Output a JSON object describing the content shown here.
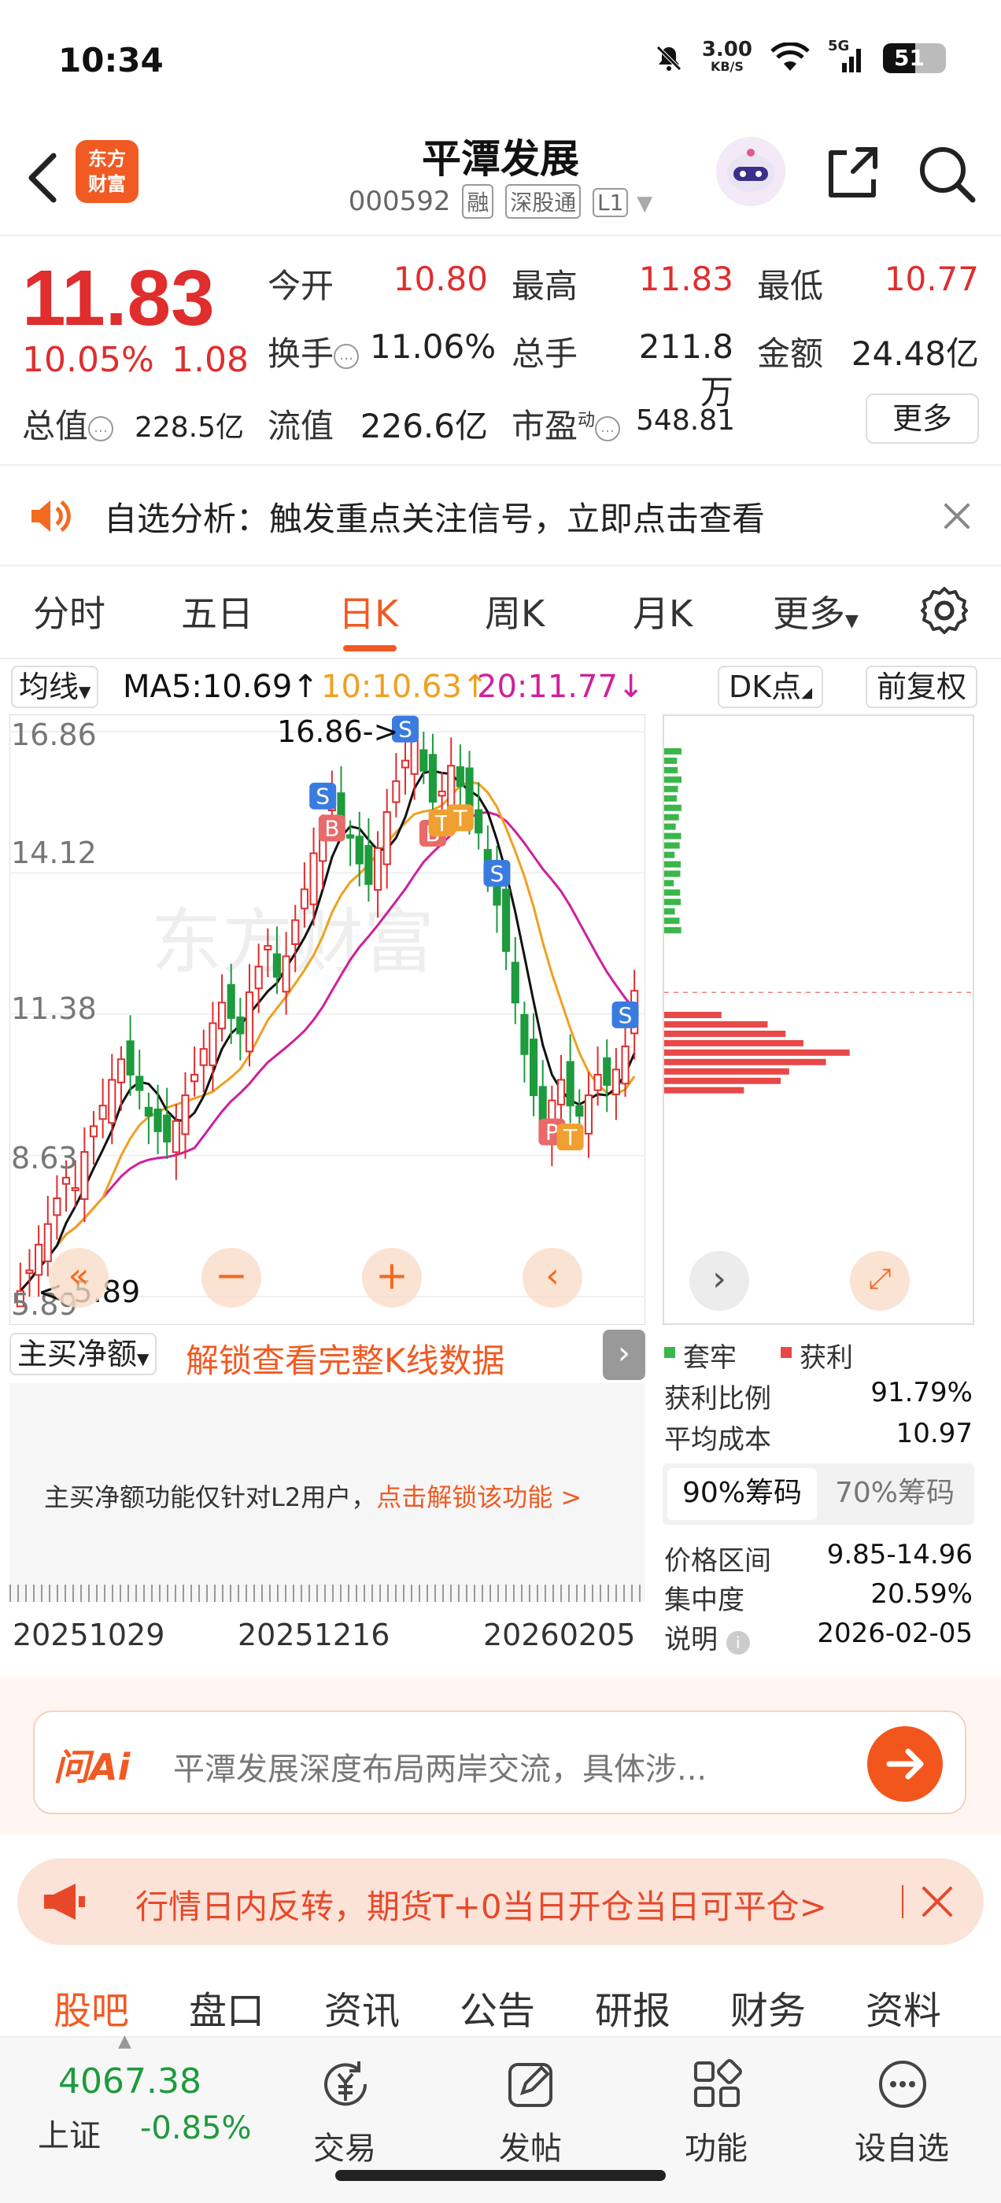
{
  "status_bar": {
    "time": "10:34",
    "net_speed": "3.00",
    "net_unit": "KB/S",
    "network": "5G",
    "battery": "51"
  },
  "header": {
    "stock_name": "平潭发展",
    "stock_code": "000592",
    "tags": [
      "融",
      "深股通",
      "L1"
    ],
    "logo_top": "东方",
    "logo_bottom": "财富"
  },
  "quote": {
    "last_price": "11.83",
    "change_pct": "10.05%",
    "change_amt": "1.08",
    "open_label": "今开",
    "open": "10.80",
    "high_label": "最高",
    "high": "11.83",
    "low_label": "最低",
    "low": "10.77",
    "turnover_label": "换手",
    "turnover": "11.06%",
    "volume_label": "总手",
    "volume": "211.8万",
    "amount_label": "金额",
    "amount": "24.48亿",
    "mktcap_label": "总值",
    "mktcap": "228.5亿",
    "float_label": "流值",
    "float_cap": "226.6亿",
    "pe_label": "市盈",
    "pe_sup": "动",
    "pe": "548.81",
    "more_label": "更多"
  },
  "alert": {
    "text": "自选分析：触发重点关注信号，立即点击查看"
  },
  "period_tabs": [
    "分时",
    "五日",
    "日K",
    "周K",
    "月K",
    "更多"
  ],
  "active_tab": "日K",
  "ma_row": {
    "selector": "均线",
    "ma5": "MA5:10.69↑",
    "ma10": "10:10.63↑",
    "ma20": "20:11.77↓",
    "dk": "DK点",
    "adjust": "前复权",
    "colors": {
      "ma5": "#111111",
      "ma10": "#f0a020",
      "ma20": "#d0209a"
    }
  },
  "kchart": {
    "axis_labels": [
      "16.86",
      "14.12",
      "11.38",
      "8.63",
      "5.89"
    ],
    "high_annotation": "16.86->",
    "low_annotation": "<-5.89"
  },
  "chart_data": {
    "type": "candlestick",
    "y_ticks": [
      16.86,
      14.12,
      11.38,
      8.63,
      5.89
    ],
    "ylim": [
      5.89,
      16.86
    ],
    "x_ticks": [
      "20251029",
      "20251216",
      "20260205"
    ],
    "close": [
      6.0,
      6.4,
      6.9,
      7.3,
      7.8,
      8.2,
      8.0,
      8.7,
      9.2,
      9.6,
      10.1,
      10.5,
      10.2,
      9.9,
      9.4,
      9.1,
      8.9,
      9.3,
      9.8,
      10.2,
      10.7,
      11.2,
      11.6,
      11.3,
      11.0,
      11.8,
      12.3,
      12.7,
      12.1,
      12.5,
      13.2,
      13.8,
      14.5,
      15.0,
      15.6,
      15.2,
      14.8,
      14.3,
      13.9,
      14.6,
      15.3,
      15.9,
      16.3,
      16.7,
      16.1,
      15.5,
      15.7,
      16.2,
      15.8,
      15.4,
      14.9,
      14.2,
      13.5,
      12.6,
      11.6,
      10.6,
      9.8,
      9.3,
      9.7,
      10.1,
      9.6,
      9.4,
      9.8,
      10.2,
      10.0,
      10.3,
      10.75,
      11.83
    ],
    "ma5_last": 10.69,
    "ma10_last": 10.63,
    "ma20_last": 11.77
  },
  "indicator": {
    "selector": "主买净额",
    "unlock_title": "解锁查看完整K线数据",
    "notice": "主买净额功能仅针对L2用户，",
    "notice_link": "点击解锁该功能 >"
  },
  "dates": [
    "20251029",
    "20251216",
    "20260205"
  ],
  "chips": {
    "legend_trapped": "套牢",
    "legend_profit": "获利",
    "rows": [
      {
        "label": "获利比例",
        "value": "91.79%"
      },
      {
        "label": "平均成本",
        "value": "10.97"
      }
    ],
    "tab_90": "90%筹码",
    "tab_70": "70%筹码",
    "rows2": [
      {
        "label": "价格区间",
        "value": "9.85-14.96"
      },
      {
        "label": "集中度",
        "value": "20.59%"
      },
      {
        "label": "说明",
        "value": "2026-02-05"
      }
    ]
  },
  "ai_bar": {
    "logo": "问Ai",
    "placeholder": "平潭发展深度布局两岸交流，具体涉..."
  },
  "promo": {
    "text": "行情日内反转，期货T+0当日开仓当日可平仓>"
  },
  "content_tabs": [
    "股吧",
    "盘口",
    "资讯",
    "公告",
    "研报",
    "财务",
    "资料"
  ],
  "bottom_nav": {
    "index_value": "4067.38",
    "index_name": "上证",
    "index_change": "-0.85%",
    "items": [
      "交易",
      "发帖",
      "功能",
      "设自选"
    ]
  }
}
